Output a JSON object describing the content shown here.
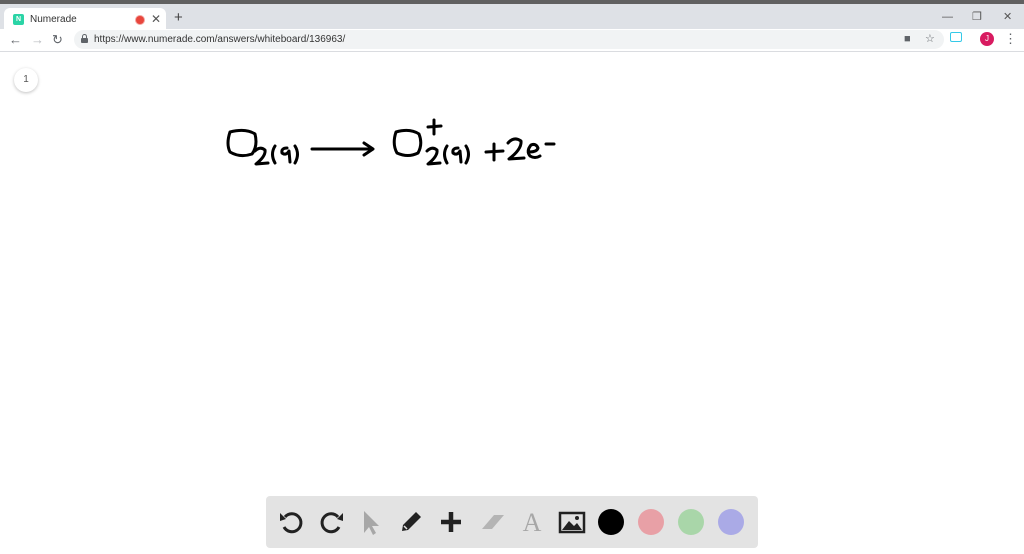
{
  "browser": {
    "tab": {
      "title": "Numerade",
      "favicon_letter": "N",
      "close_glyph": "✕"
    },
    "new_tab_glyph": "+",
    "window_controls": {
      "minimize": "—",
      "restore": "❐",
      "close": "✕"
    },
    "address": {
      "url": "https://www.numerade.com/answers/whiteboard/136963/"
    },
    "profile_initial": "J"
  },
  "whiteboard": {
    "page_number": "1",
    "equation_ink": "O2(g) ⟶ O2+(g) + 2e−"
  },
  "tools": [
    {
      "name": "undo",
      "icon": "undo-icon"
    },
    {
      "name": "redo",
      "icon": "redo-icon"
    },
    {
      "name": "select",
      "icon": "pointer-icon"
    },
    {
      "name": "pen",
      "icon": "pencil-icon"
    },
    {
      "name": "add",
      "icon": "plus-icon"
    },
    {
      "name": "eraser",
      "icon": "eraser-icon"
    },
    {
      "name": "text",
      "icon": "text-icon",
      "glyph": "A"
    },
    {
      "name": "image",
      "icon": "image-icon"
    }
  ],
  "colors": {
    "black": "#000000",
    "red": "#e8a0a6",
    "green": "#a9d6a9",
    "blue": "#aaaae6",
    "accent_tab_record": "#e8453c"
  }
}
